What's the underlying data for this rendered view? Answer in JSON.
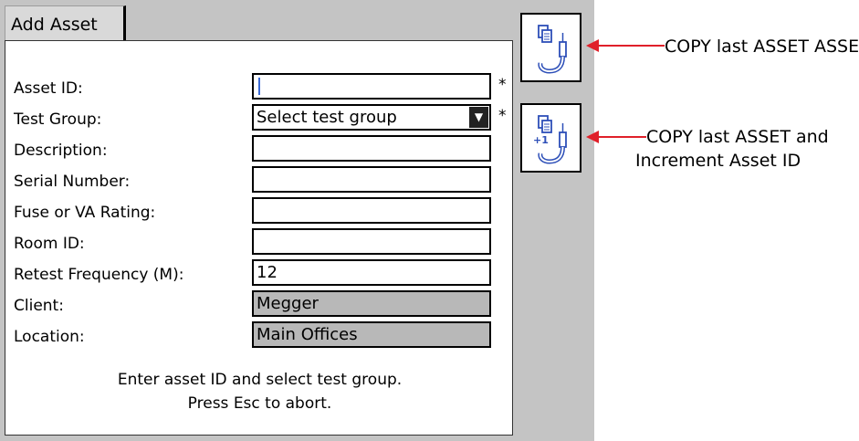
{
  "tab": {
    "label": "Add Asset"
  },
  "form": {
    "asset_id": {
      "label": "Asset ID:",
      "value": "",
      "required": "*"
    },
    "test_group": {
      "label": "Test Group:",
      "value": "Select test group",
      "required": "*"
    },
    "description": {
      "label": "Description:",
      "value": ""
    },
    "serial_number": {
      "label": "Serial Number:",
      "value": ""
    },
    "fuse_rating": {
      "label": "Fuse or VA Rating:",
      "value": ""
    },
    "room_id": {
      "label": "Room ID:",
      "value": ""
    },
    "retest_frequency": {
      "label": "Retest Frequency (M):",
      "value": "12"
    },
    "client": {
      "label": "Client:",
      "value": "Megger"
    },
    "location": {
      "label": "Location:",
      "value": "Main Offices"
    }
  },
  "message": {
    "line1": "Enter asset ID and select test group.",
    "line2": "Press Esc to abort."
  },
  "side_buttons": {
    "copy_icon": "copy-asset-icon",
    "copy_increment_icon": "copy-increment-icon"
  },
  "annotations": {
    "copy_line1": "COPY last ASSET ASSET",
    "copy_increment_line1": "COPY last ASSET and",
    "copy_increment_line2": "Increment Asset ID"
  },
  "colors": {
    "screen_bg": "#c4c4c4",
    "readonly_bg": "#b8b8b8",
    "arrow": "#e0202a",
    "cursor": "#3b6bd6"
  }
}
